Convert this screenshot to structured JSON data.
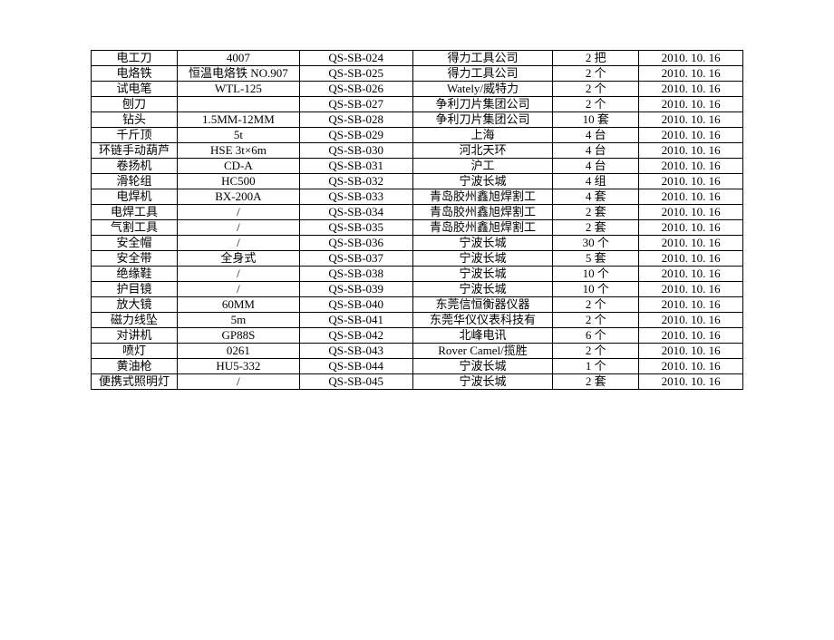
{
  "table": {
    "rows": [
      {
        "c1": "电工刀",
        "c2": "4007",
        "c3": "QS-SB-024",
        "c4": "得力工具公司",
        "c5": "2 把",
        "c6": "2010. 10. 16"
      },
      {
        "c1": "电烙铁",
        "c2": "恒温电烙铁 NO.907",
        "c3": "QS-SB-025",
        "c4": "得力工具公司",
        "c5": "2 个",
        "c6": "2010. 10. 16"
      },
      {
        "c1": "试电笔",
        "c2": "WTL-125",
        "c3": "QS-SB-026",
        "c4": "Wately/威特力",
        "c5": "2 个",
        "c6": "2010. 10. 16"
      },
      {
        "c1": "刨刀",
        "c2": "",
        "c3": "QS-SB-027",
        "c4": "争利刀片集团公司",
        "c5": "2 个",
        "c6": "2010. 10. 16"
      },
      {
        "c1": "钻头",
        "c2": "1.5MM-12MM",
        "c3": "QS-SB-028",
        "c4": "争利刀片集团公司",
        "c5": "10 套",
        "c6": "2010. 10. 16"
      },
      {
        "c1": "千斤顶",
        "c2": "5t",
        "c3": "QS-SB-029",
        "c4": "上海",
        "c5": "4 台",
        "c6": "2010. 10. 16"
      },
      {
        "c1": "环链手动葫芦",
        "c2": "HSE 3t×6m",
        "c3": "QS-SB-030",
        "c4": "河北天环",
        "c5": "4 台",
        "c6": "2010. 10. 16"
      },
      {
        "c1": "卷扬机",
        "c2": "CD-A",
        "c3": "QS-SB-031",
        "c4": "沪工",
        "c5": "4 台",
        "c6": "2010. 10. 16"
      },
      {
        "c1": "滑轮组",
        "c2": "HC500",
        "c3": "QS-SB-032",
        "c4": "宁波长城",
        "c5": "4 组",
        "c6": "2010. 10. 16"
      },
      {
        "c1": "电焊机",
        "c2": "BX-200A",
        "c3": "QS-SB-033",
        "c4": "青岛胶州鑫旭焊割工",
        "c5": "4 套",
        "c6": "2010. 10. 16"
      },
      {
        "c1": "电焊工具",
        "c2": "/",
        "c3": "QS-SB-034",
        "c4": "青岛胶州鑫旭焊割工",
        "c5": "2 套",
        "c6": "2010. 10. 16"
      },
      {
        "c1": "气割工具",
        "c2": "/",
        "c3": "QS-SB-035",
        "c4": "青岛胶州鑫旭焊割工",
        "c5": "2 套",
        "c6": "2010. 10. 16"
      },
      {
        "c1": "安全帽",
        "c2": "/",
        "c3": "QS-SB-036",
        "c4": "宁波长城",
        "c5": "30 个",
        "c6": "2010. 10. 16"
      },
      {
        "c1": "安全带",
        "c2": "全身式",
        "c3": "QS-SB-037",
        "c4": "宁波长城",
        "c5": "5 套",
        "c6": "2010. 10. 16"
      },
      {
        "c1": "绝缘鞋",
        "c2": "/",
        "c3": "QS-SB-038",
        "c4": "宁波长城",
        "c5": "10 个",
        "c6": "2010. 10. 16"
      },
      {
        "c1": "护目镜",
        "c2": "/",
        "c3": "QS-SB-039",
        "c4": "宁波长城",
        "c5": "10 个",
        "c6": "2010. 10. 16"
      },
      {
        "c1": "放大镜",
        "c2": "60MM",
        "c3": "QS-SB-040",
        "c4": "东莞信恒衡器仪器",
        "c5": "2 个",
        "c6": "2010. 10. 16"
      },
      {
        "c1": "磁力线坠",
        "c2": "5m",
        "c3": "QS-SB-041",
        "c4": "东莞华仪仪表科技有",
        "c5": "2 个",
        "c6": "2010. 10. 16"
      },
      {
        "c1": "对讲机",
        "c2": "GP88S",
        "c3": "QS-SB-042",
        "c4": "北峰电讯",
        "c5": "6 个",
        "c6": "2010. 10. 16"
      },
      {
        "c1": "喷灯",
        "c2": "0261",
        "c3": "QS-SB-043",
        "c4": "Rover Camel/揽胜",
        "c5": "2 个",
        "c6": "2010. 10. 16"
      },
      {
        "c1": "黄油枪",
        "c2": "HU5-332",
        "c3": "QS-SB-044",
        "c4": "宁波长城",
        "c5": "1 个",
        "c6": "2010. 10. 16"
      },
      {
        "c1": "便携式照明灯",
        "c2": "/",
        "c3": "QS-SB-045",
        "c4": "宁波长城",
        "c5": "2 套",
        "c6": "2010. 10. 16"
      }
    ]
  }
}
